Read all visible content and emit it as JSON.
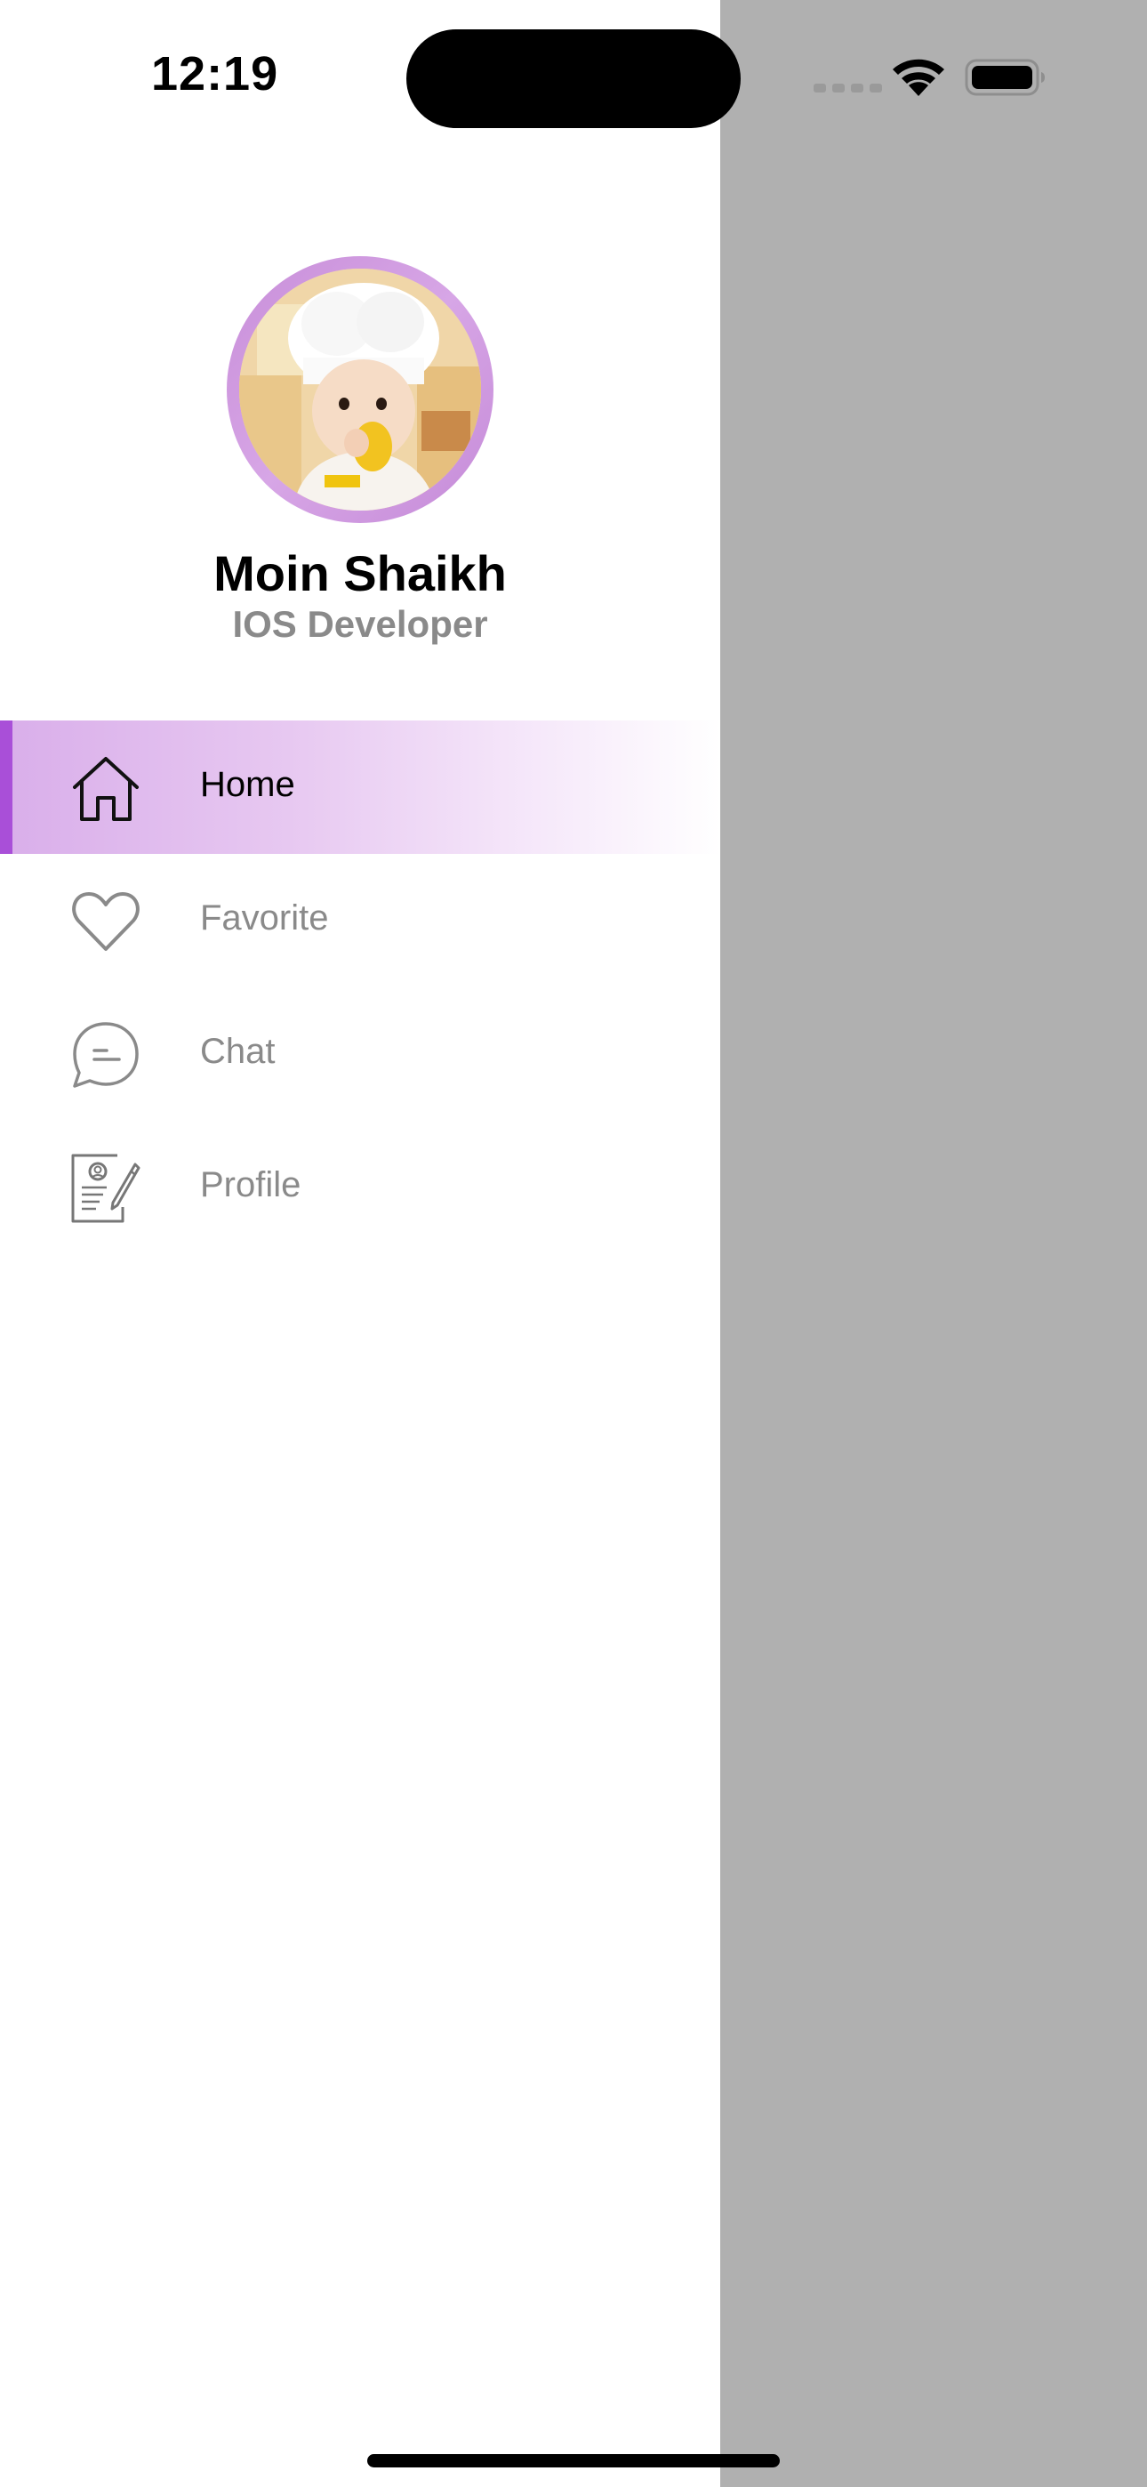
{
  "status_bar": {
    "time": "12:19"
  },
  "profile": {
    "name": "Moin Shaikh",
    "role": "IOS Developer",
    "avatar_icon": "avatar-photo",
    "avatar_ring_color": "#c88ed9"
  },
  "menu": {
    "items": [
      {
        "label": "Home",
        "icon": "home-icon",
        "active": true
      },
      {
        "label": "Favorite",
        "icon": "heart-icon",
        "active": false
      },
      {
        "label": "Chat",
        "icon": "chat-icon",
        "active": false
      },
      {
        "label": "Profile",
        "icon": "profile-document-icon",
        "active": false
      }
    ]
  },
  "colors": {
    "accent": "#a94fd8",
    "active_gradient_start": "#d9aeea",
    "inactive_text": "#8a8a8a",
    "overlay": "#b0b0b0"
  }
}
